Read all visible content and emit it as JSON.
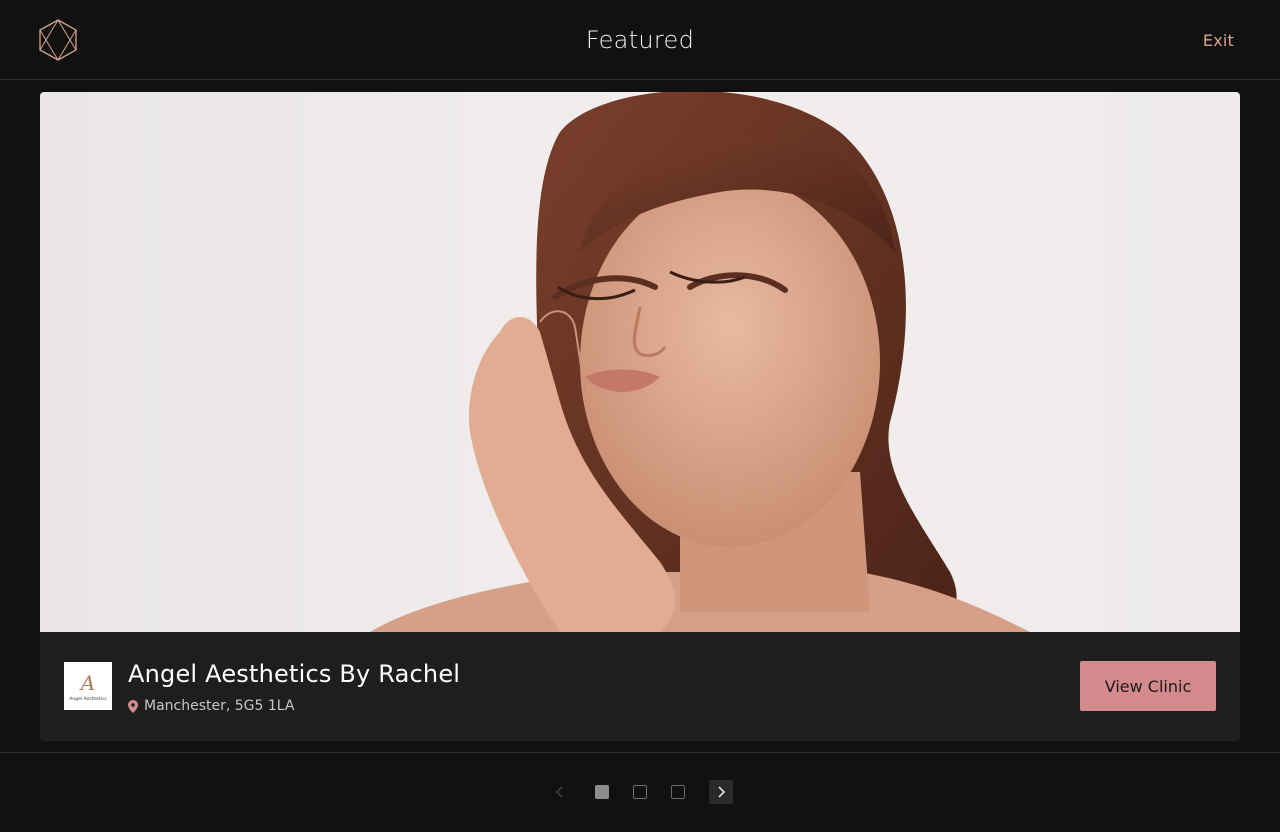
{
  "header": {
    "title": "Featured",
    "exit_label": "Exit",
    "logo_icon": "hexagon-logo-icon",
    "accent_color": "#d9a48c"
  },
  "featured": {
    "clinic_name": "Angel Aesthetics By Rachel",
    "location": "Manchester, 5G5 1LA",
    "location_icon": "map-pin-icon",
    "clinic_logo_text": "Angel Aesthetics",
    "view_button_label": "View Clinic",
    "button_color": "#d48a8d"
  },
  "pagination": {
    "current_page": 1,
    "total_pages": 3,
    "prev_icon": "chevron-left-icon",
    "next_icon": "chevron-right-icon"
  }
}
